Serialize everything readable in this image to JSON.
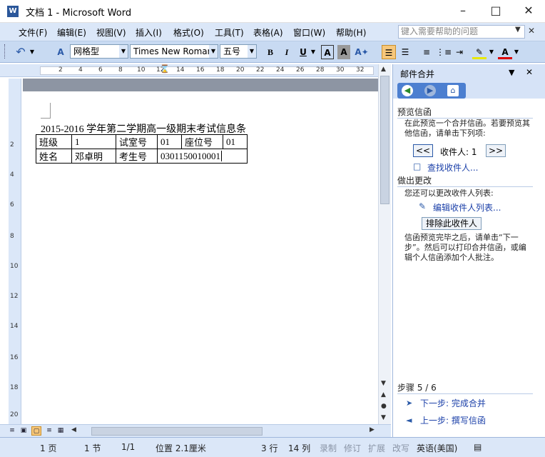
{
  "window": {
    "title": "文档 1 - Microsoft Word",
    "app_icon": "W"
  },
  "menu": [
    "文件(F)",
    "编辑(E)",
    "视图(V)",
    "插入(I)",
    "格式(O)",
    "工具(T)",
    "表格(A)",
    "窗口(W)",
    "帮助(H)"
  ],
  "help_search": {
    "placeholder": "键入需要帮助的问题"
  },
  "toolbar": {
    "style": "网格型",
    "font": "Times New Roman",
    "size": "五号",
    "bold": "B",
    "italic": "I",
    "underline": "U"
  },
  "ruler": {
    "ticks": [
      "2",
      "4",
      "6",
      "8",
      "10",
      "12",
      "14",
      "16",
      "18",
      "20",
      "22",
      "24",
      "26",
      "28",
      "30",
      "32"
    ]
  },
  "vruler": {
    "ticks": [
      "2",
      "4",
      "6",
      "8",
      "10",
      "12",
      "14",
      "16",
      "18",
      "20"
    ]
  },
  "document": {
    "title": "2015-2016 学年第二学期高一级期末考试信息条",
    "row1": [
      "班级",
      "1",
      "试室号",
      "01",
      "座位号",
      "01"
    ],
    "row2": [
      "姓名",
      "邓卓明",
      "考生号",
      "0301150010001"
    ]
  },
  "taskpane": {
    "title": "邮件合并",
    "preview_heading": "预览信函",
    "preview_text": "在此预览一个合并信函。若要预览其他信函，请单击下列项:",
    "recipient_label": "收件人: 1",
    "prev_btn": "<<",
    "next_btn": ">>",
    "find_link": "查找收件人...",
    "changes_heading": "做出更改",
    "changes_text": "您还可以更改收件人列表:",
    "edit_link": "编辑收件人列表...",
    "exclude_btn": "排除此收件人",
    "finish_text": "信函预览完毕之后，请单击“下一步”。然后可以打印合并信函，或编辑个人信函添加个人批注。",
    "step": "步骤 5 / 6",
    "next_step": "下一步: 完成合并",
    "prev_step": "上一步: 撰写信函"
  },
  "status": {
    "page": "1 页",
    "section": "1 节",
    "pages": "1/1",
    "position": "位置 2.1厘米",
    "line": "3 行",
    "col": "14 列",
    "rec": "录制",
    "trk": "修订",
    "ext": "扩展",
    "ovr": "改写",
    "lang": "英语(美国)"
  },
  "colors": {
    "menubar": "#dbe7f8",
    "toolbar": "#c8daf2",
    "taskpane_header": "#d6e3f7",
    "link": "#1a3fa8"
  }
}
